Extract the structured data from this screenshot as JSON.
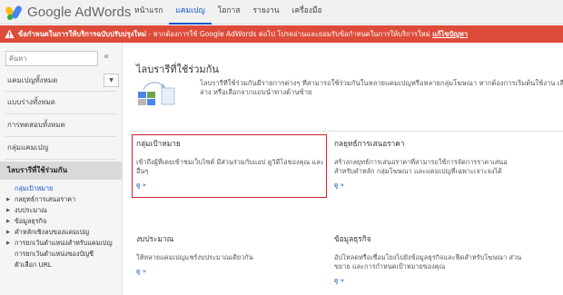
{
  "header": {
    "logo_text": "Google AdWords",
    "tabs": [
      {
        "label": "หน้าแรก"
      },
      {
        "label": "แคมเปญ"
      },
      {
        "label": "โอกาส"
      },
      {
        "label": "รายงาน"
      },
      {
        "label": "เครื่องมือ"
      }
    ],
    "active_tab": "แคมเปญ"
  },
  "alert": {
    "bold_text": "ข้อกำหนดในการให้บริการฉบับปรับปรุงใหม่",
    "text": " - หากต้องการใช้ Google AdWords ต่อไป โปรดอ่านและยอมรับข้อกำหนดในการให้บริการใหม่",
    "link": "แก้ไขปัญหา",
    "color": "#dd4b39"
  },
  "sidebar": {
    "search_placeholder": "ค้นหา",
    "collapse_icon": "«",
    "items": [
      {
        "label": "แคมเปญทั้งหมด"
      },
      {
        "label": "แบบร่างทั้งหมด"
      },
      {
        "label": "การทดสอบทั้งหมด"
      },
      {
        "label": "กลุ่มแคมเปญ"
      },
      {
        "label": "ไลบรารีที่ใช้ร่วมกัน"
      }
    ],
    "sub_items": [
      {
        "label": "กลุ่มเป้าหมาย"
      },
      {
        "label": "กลยุทธ์การเสนอราคา"
      },
      {
        "label": "งบประมาณ"
      },
      {
        "label": "ข้อมูลธุรกิจ"
      },
      {
        "label": "คำหลักเชิงลบของแคมเปญ"
      },
      {
        "label": "การยกเว้นตำแหน่งสำหรับแคมเปญ"
      },
      {
        "label": "การยกเว้นตำแหน่งของบัญชี"
      },
      {
        "label": "ตัวเลือก URL"
      }
    ]
  },
  "main": {
    "title": "ไลบรารีที่ใช้ร่วมกัน",
    "intro_line1": "ไลบรารีที่ใช้ร่วมกันมีรายการต่างๆ ที่สามารถใช้ร่วมกันในหลายแคมเปญหรือหลายกลุ่มโฆษณา หากต้องการเริ่มต้นใช้งาน เลือ",
    "intro_line2": "ล่าง หรือเลือกจากแถบนำทางด้านซ้าย",
    "cards": [
      {
        "title": "กลุ่มเป้าหมาย",
        "desc1": "เข้าถึงผู้ที่เคยเข้าชมเว็บไซต์ มีส่วนร่วมกับแอป ดูวิดีโอของคุณ และ",
        "desc2": "อื่นๆ",
        "link": "ดู »"
      },
      {
        "title": "กลยุทธ์การเสนอราคา",
        "desc1": "สร้างกลยุทธ์การเสนอราคาที่สามารถใช้การจัดการราคาเสนอ",
        "desc2": "สำหรับคำหลัก กลุ่มโฆษณา และแคมเปญที่เฉพาะเจาะจงได้",
        "link": "ดู »"
      },
      {
        "title": "งบประมาณ",
        "desc1": "ให้หลายแคมเปญแชร์งบประมาณเดียวกัน",
        "desc2": "",
        "link": "ดู »"
      },
      {
        "title": "ข้อมูลธุรกิจ",
        "desc1": "อัปโหลดหรือเชื่อมโยงไปยังข้อมูลธุรกิจและฟีดสำหรับโฆษณา ส่วน",
        "desc2": "ขยาย และการกำหนดเป้าหมายของคุณ",
        "link": "ดู »"
      }
    ]
  }
}
